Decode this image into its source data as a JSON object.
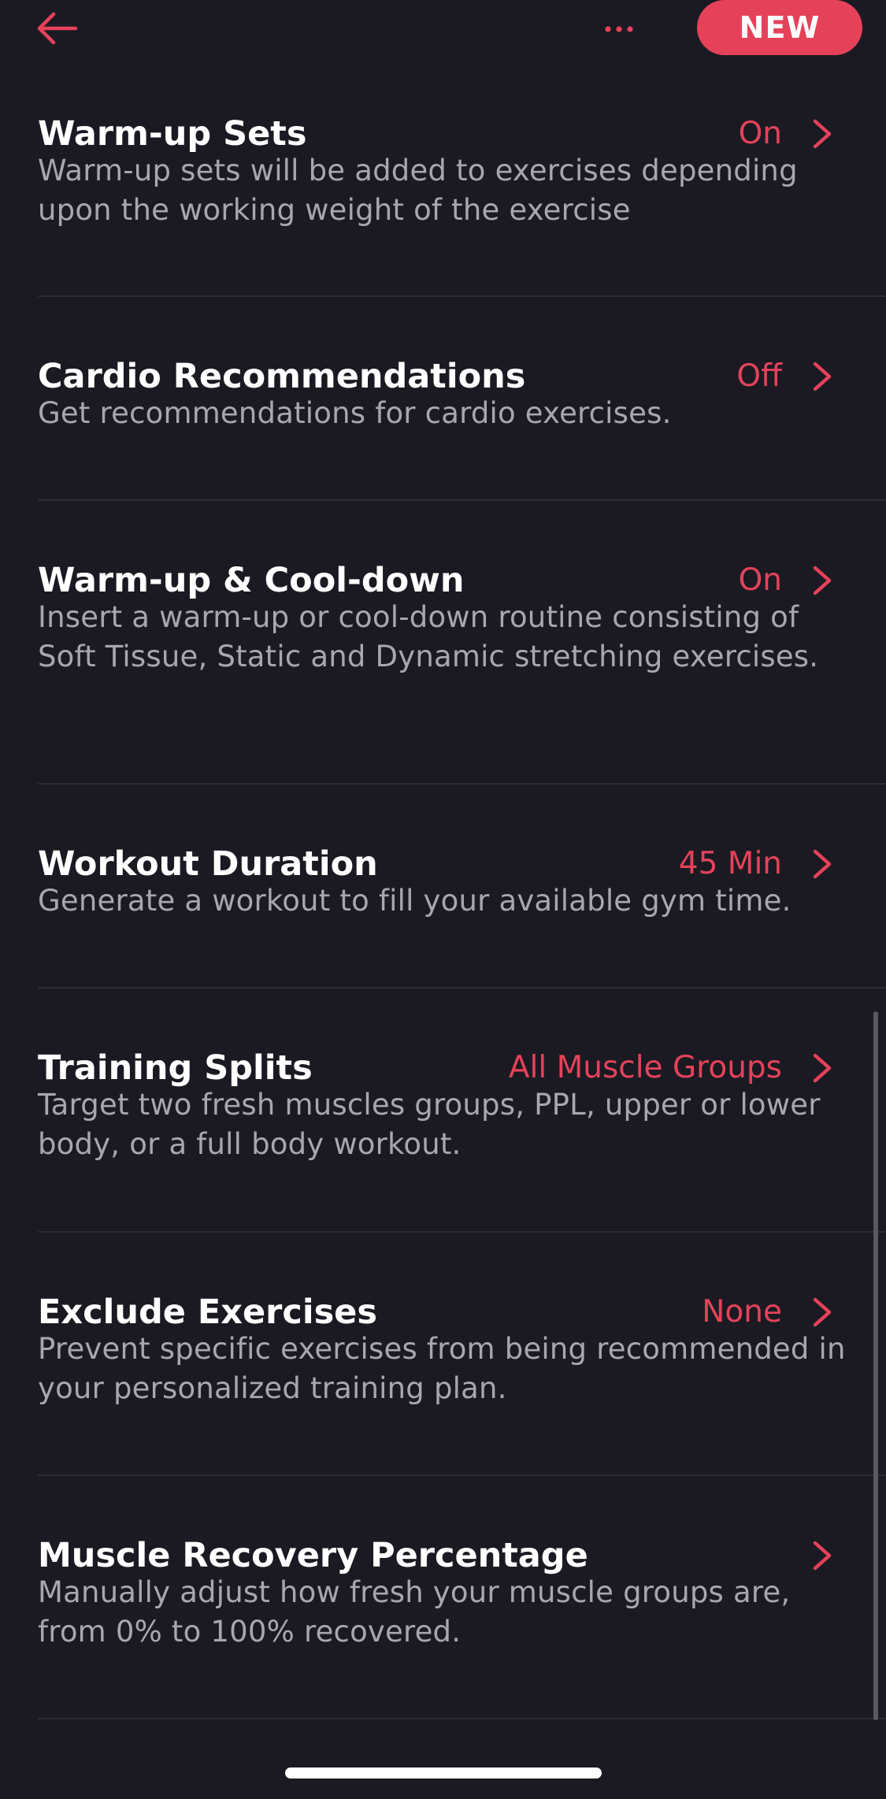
{
  "header": {
    "back_icon": "arrow-left-icon",
    "more_icon": "ellipsis-icon",
    "new_label": "NEW"
  },
  "colors": {
    "background": "#1b1a22",
    "accent": "#e5425a",
    "title": "#ffffff",
    "description": "#a8a7ae",
    "divider": "#2c2b34"
  },
  "settings": [
    {
      "title": "Warm-up Sets",
      "value": "On",
      "description": "Warm-up sets will be added to exercises depending upon the working weight of the exercise"
    },
    {
      "title": "Cardio Recommendations",
      "value": "Off",
      "description": "Get recommendations for cardio exercises."
    },
    {
      "title": "Warm-up & Cool-down",
      "value": "On",
      "description": "Insert a warm-up or cool-down routine consisting of Soft Tissue, Static and Dynamic stretching exercises."
    },
    {
      "title": "Workout Duration",
      "value": "45 Min",
      "description": "Generate a workout to fill your available gym time."
    },
    {
      "title": "Training Splits",
      "value": "All Muscle Groups",
      "description": "Target two fresh muscles groups, PPL, upper or lower body, or a full body workout."
    },
    {
      "title": "Exclude Exercises",
      "value": "None",
      "description": "Prevent specific exercises from being recommended in your personalized training plan."
    },
    {
      "title": "Muscle Recovery Percentage",
      "value": "",
      "description": "Manually adjust how fresh your muscle groups are, from 0% to 100% recovered."
    }
  ]
}
